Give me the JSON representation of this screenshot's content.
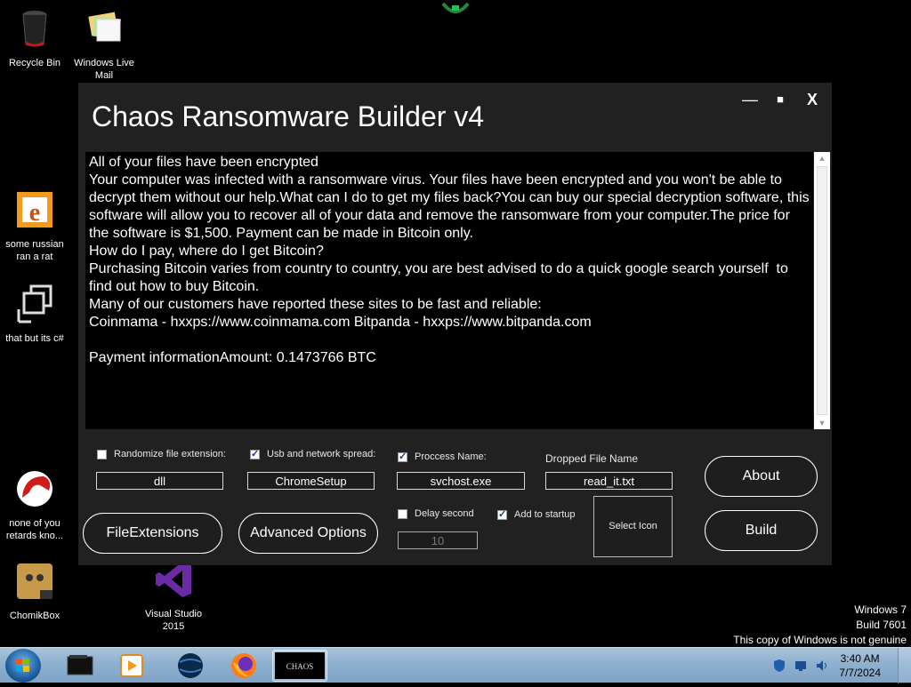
{
  "desktop": {
    "icons": [
      {
        "label": "Recycle Bin"
      },
      {
        "label": "Windows Live Mail"
      },
      {
        "label": "some russian ran a rat"
      },
      {
        "label": "that but its c#"
      },
      {
        "label": "none of you retards kno..."
      },
      {
        "label": "ChomikBox"
      },
      {
        "label": "Visual Studio 2015"
      }
    ],
    "watermark": {
      "line1": "Windows 7",
      "line2": "Build 7601",
      "line3": "This copy of Windows is not genuine"
    }
  },
  "window": {
    "title": "Chaos Ransomware Builder v4",
    "controls": {
      "minimize": "—",
      "maximize": "■",
      "close": "X"
    },
    "note": "All of your files have been encrypted\nYour computer was infected with a ransomware virus. Your files have been encrypted and you won't be able to decrypt them without our help.What can I do to get my files back?You can buy our special decryption software, this software will allow you to recover all of your data and remove the ransomware from your computer.The price for the software is $1,500. Payment can be made in Bitcoin only.\nHow do I pay, where do I get Bitcoin?\nPurchasing Bitcoin varies from country to country, you are best advised to do a quick google search yourself  to find out how to buy Bitcoin.\nMany of our customers have reported these sites to be fast and reliable:\nCoinmama - hxxps://www.coinmama.com Bitpanda - hxxps://www.bitpanda.com\n\nPayment informationAmount: 0.1473766 BTC",
    "options": {
      "randomize_ext": {
        "label": "Randomize file extension:",
        "checked": false,
        "value": "dll"
      },
      "usb_spread": {
        "label": "Usb and network spread:",
        "checked": true,
        "value": "ChromeSetup"
      },
      "process_name": {
        "label": "Proccess Name:",
        "checked": true,
        "value": "svchost.exe"
      },
      "dropped_file": {
        "label": "Dropped File Name",
        "value": "read_it.txt"
      },
      "delay_second": {
        "label": "Delay second",
        "checked": false,
        "value": "10"
      },
      "add_startup": {
        "label": "Add to startup",
        "checked": true
      }
    },
    "buttons": {
      "file_extensions": "FileExtensions",
      "advanced_options": "Advanced Options",
      "select_icon": "Select Icon",
      "about": "About",
      "build": "Build"
    }
  },
  "taskbar": {
    "pinned": [
      "windows-explorer",
      "media-player",
      "browser-globe",
      "firefox",
      "chaos-builder"
    ],
    "active": "chaos-builder",
    "chaos_label": "CHAOS",
    "clock": {
      "time": "3:40 AM",
      "date": "7/7/2024"
    }
  }
}
